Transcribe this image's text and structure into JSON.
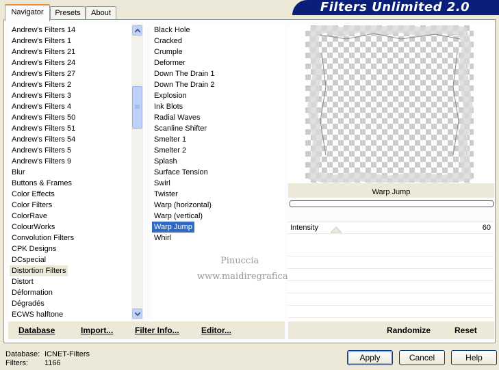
{
  "tabs": [
    "Navigator",
    "Presets",
    "About"
  ],
  "banner_title": "Filters Unlimited 2.0",
  "categories": [
    "Andrew's Filters 14",
    "Andrew's Filters 1",
    "Andrew's Filters 21",
    "Andrew's Filters 24",
    "Andrew's Filters 27",
    "Andrew's Filters 2",
    "Andrew's Filters 3",
    "Andrew's Filters 4",
    "Andrew's Filters 50",
    "Andrew's Filters 51",
    "Andrew's Filters 54",
    "Andrew's Filters 5",
    "Andrew's Filters 9",
    "Blur",
    "Buttons & Frames",
    "Color Effects",
    "Color Filters",
    "ColorRave",
    "ColourWorks",
    "Convolution Filters",
    "CPK Designs",
    "DCspecial",
    "Distortion Filters",
    "Distort",
    "Déformation",
    "Dégradés",
    "ECWS halftone"
  ],
  "selected_category": "Distortion Filters",
  "filters": [
    "Black Hole",
    "Cracked",
    "Crumple",
    "Deformer",
    "Down The Drain 1",
    "Down The Drain 2",
    "Explosion",
    "Ink Blots",
    "Radial Waves",
    "Scanline Shifter",
    "Smelter 1",
    "Smelter 2",
    "Splash",
    "Surface Tension",
    "Swirl",
    "Twister",
    "Warp (horizontal)",
    "Warp (vertical)",
    "Warp Jump",
    "Whirl"
  ],
  "selected_filter": "Warp Jump",
  "watermark": {
    "line1": "Pinuccia",
    "line2": "www.maidiregrafica.eu"
  },
  "preview": {
    "filter_name": "Warp Jump"
  },
  "params": {
    "label": "Intensity",
    "value": "60"
  },
  "left_buttons": {
    "database": "Database",
    "import": "Import...",
    "filter_info": "Filter Info...",
    "editor": "Editor..."
  },
  "right_buttons": {
    "randomize": "Randomize",
    "reset": "Reset"
  },
  "status": {
    "db_label": "Database:",
    "db_value": "ICNET-Filters",
    "filters_label": "Filters:",
    "filters_value": "1166"
  },
  "dialog_buttons": {
    "apply": "Apply",
    "cancel": "Cancel",
    "help": "Help"
  }
}
